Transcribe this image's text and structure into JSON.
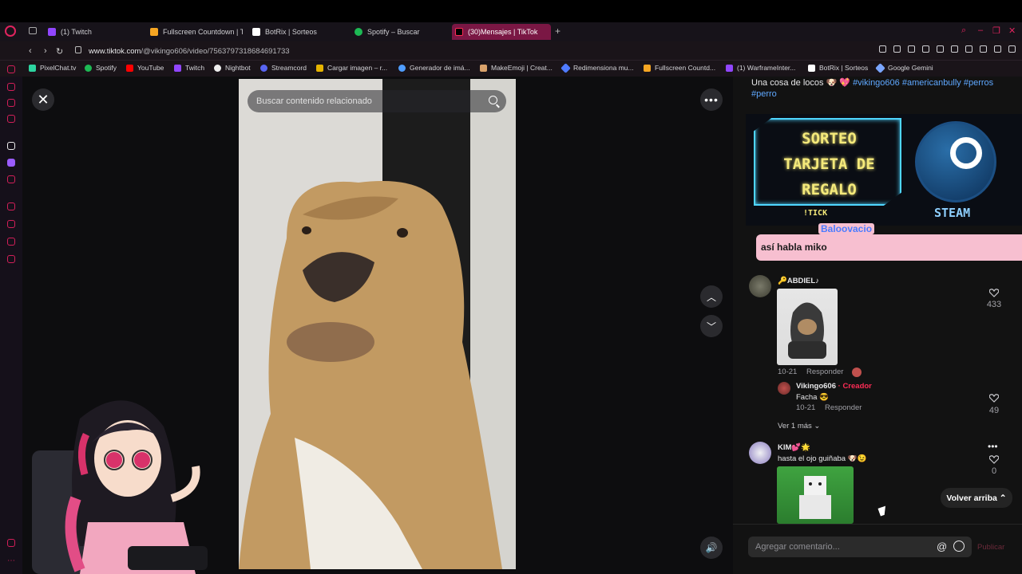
{
  "browser": {
    "tabs": [
      {
        "label": "(1) Twitch",
        "color": "#9146ff"
      },
      {
        "label": "Fullscreen Countdown | T",
        "color": "#f6a623"
      },
      {
        "label": "BotRix | Sorteos",
        "color": "#ffffff"
      },
      {
        "label": "Spotify – Buscar",
        "color": "#1db954"
      },
      {
        "label": "(30)Mensajes | TikTok",
        "color": "#000000"
      }
    ],
    "url_host": "www.tiktok.com",
    "url_path": "/@vikingo606/video/7563797318684691733",
    "bookmarks": [
      {
        "label": "PixelChat.tv",
        "color": "#2dd4a0"
      },
      {
        "label": "Spotify",
        "color": "#1db954"
      },
      {
        "label": "YouTube",
        "color": "#ff0000"
      },
      {
        "label": "Twitch",
        "color": "#9146ff"
      },
      {
        "label": "Nightbot",
        "color": "#eeeeee"
      },
      {
        "label": "Streamcord",
        "color": "#5865f2"
      },
      {
        "label": "Cargar imagen – r...",
        "color": "#e5b400"
      },
      {
        "label": "Generador de imá...",
        "color": "#4f9dff"
      },
      {
        "label": "MakeEmoji | Creat...",
        "color": "#d9a26b"
      },
      {
        "label": "Redimensiona mu...",
        "color": "#4f7bff"
      },
      {
        "label": "Fullscreen Countd...",
        "color": "#f6a623"
      },
      {
        "label": "(1) WarframeInter...",
        "color": "#9146ff"
      },
      {
        "label": "BotRix | Sorteos",
        "color": "#ffffff"
      },
      {
        "label": "Google Gemini",
        "color": "#7aa6ff"
      }
    ]
  },
  "video": {
    "search_placeholder": "Buscar contenido relacionado"
  },
  "caption": {
    "text": "Una cosa de locos 🐶 💖 ",
    "tags": "#vikingo606 #americanbully #perros #perro"
  },
  "overlay": {
    "sorteo_line1": "SORTEO",
    "sorteo_line2": "TARJETA DE",
    "sorteo_line3": "REGALO",
    "tick": "!TICK",
    "steam": "STEAM",
    "chat_user": "Baloovacio",
    "chat_message": "así habla miko"
  },
  "comments": [
    {
      "user": "🔑ABDIEL♪",
      "date": "10-21",
      "reply": "Responder",
      "likes": "433",
      "replies": [
        {
          "user": "Vikingo606",
          "badge": "· Creador",
          "text": "Facha 😎",
          "date": "10-21",
          "reply": "Responder",
          "likes": "49"
        }
      ],
      "more": "Ver 1 más"
    },
    {
      "user": "KIM💕🌟",
      "text": "hasta el ojo guiñaba 🐶😉",
      "likes": "0"
    }
  ],
  "back_to_top": "Volver arriba ⌃",
  "comment_placeholder": "Agregar comentario...",
  "publish": "Publicar",
  "accent": "#fe2c55"
}
